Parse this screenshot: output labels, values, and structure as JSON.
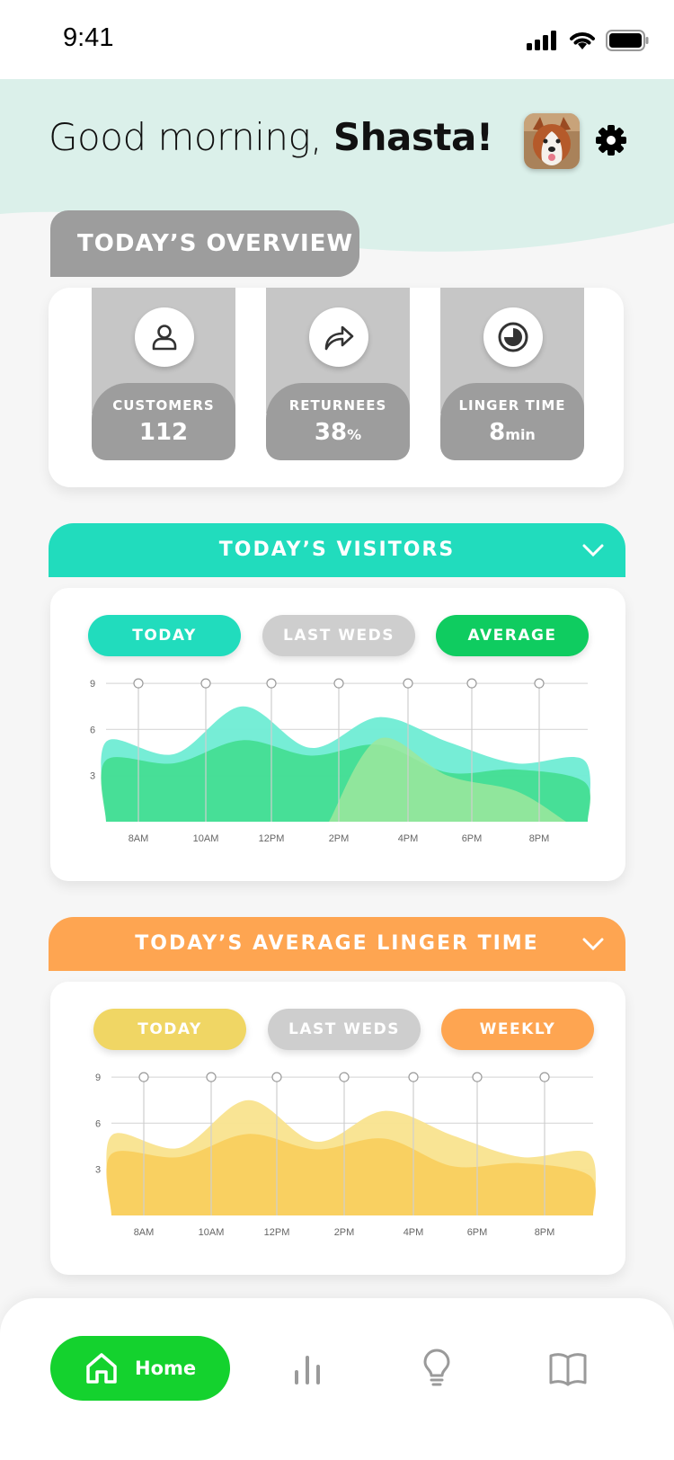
{
  "status_bar": {
    "time": "9:41"
  },
  "header": {
    "greeting": "Good morning, ",
    "name": "Shasta!"
  },
  "overview": {
    "tab_label": "TODAY’S OVERVIEW",
    "metrics": [
      {
        "label": "CUSTOMERS",
        "value": "112",
        "unit": "",
        "icon": "person-icon"
      },
      {
        "label": "RETURNEES",
        "value": "38",
        "unit": "%",
        "icon": "share-arrow-icon"
      },
      {
        "label": "LINGER TIME",
        "value": "8",
        "unit": "min",
        "icon": "timer-icon"
      }
    ]
  },
  "visitors": {
    "title": "TODAY’S VISITORS",
    "color": "#21dcbd",
    "pills": [
      {
        "label": "TODAY",
        "color": "#21dcbd"
      },
      {
        "label": "LAST WEDS",
        "color": "#cecece"
      },
      {
        "label": "AVERAGE",
        "color": "#0fcc60"
      }
    ]
  },
  "linger": {
    "title": "TODAY’S AVERAGE LINGER TIME",
    "color": "#fea551",
    "pills": [
      {
        "label": "TODAY",
        "color": "#f0d664"
      },
      {
        "label": "LAST WEDS",
        "color": "#cecece"
      },
      {
        "label": "WEEKLY",
        "color": "#fea551"
      }
    ]
  },
  "chart_data": [
    {
      "type": "area",
      "title": "",
      "x": [
        "8AM",
        "10AM",
        "12PM",
        "2PM",
        "4PM",
        "6PM",
        "8PM"
      ],
      "yticks": [
        3,
        6,
        9
      ],
      "ylim": [
        0,
        10
      ],
      "grid": true,
      "series": [
        {
          "name": "TODAY",
          "color": "#6fecd4",
          "values": [
            5.2,
            4.4,
            7.5,
            4.8,
            6.8,
            5.2,
            3.8,
            4.0
          ]
        },
        {
          "name": "AVERAGE",
          "color": "#40dc8c",
          "values": [
            4.0,
            3.8,
            5.3,
            4.3,
            5.0,
            3.2,
            3.4,
            2.6
          ]
        },
        {
          "name": "LAST WEDS",
          "color": "#9ee89c",
          "values": [
            0,
            0,
            0,
            0,
            5.4,
            3.0,
            2.0,
            0
          ]
        }
      ]
    },
    {
      "type": "area",
      "title": "",
      "x": [
        "8AM",
        "10AM",
        "12PM",
        "2PM",
        "4PM",
        "6PM",
        "8PM"
      ],
      "yticks": [
        3,
        6,
        9
      ],
      "ylim": [
        0,
        10
      ],
      "grid": true,
      "series": [
        {
          "name": "TODAY",
          "color": "#f9e38e",
          "values": [
            5.2,
            4.4,
            7.5,
            4.8,
            6.8,
            5.2,
            3.8,
            4.0
          ]
        },
        {
          "name": "WEEKLY",
          "color": "#f9cd58",
          "values": [
            4.0,
            3.8,
            5.3,
            4.3,
            5.0,
            3.2,
            3.4,
            2.6
          ]
        }
      ]
    }
  ],
  "nav": {
    "home_label": "Home"
  }
}
